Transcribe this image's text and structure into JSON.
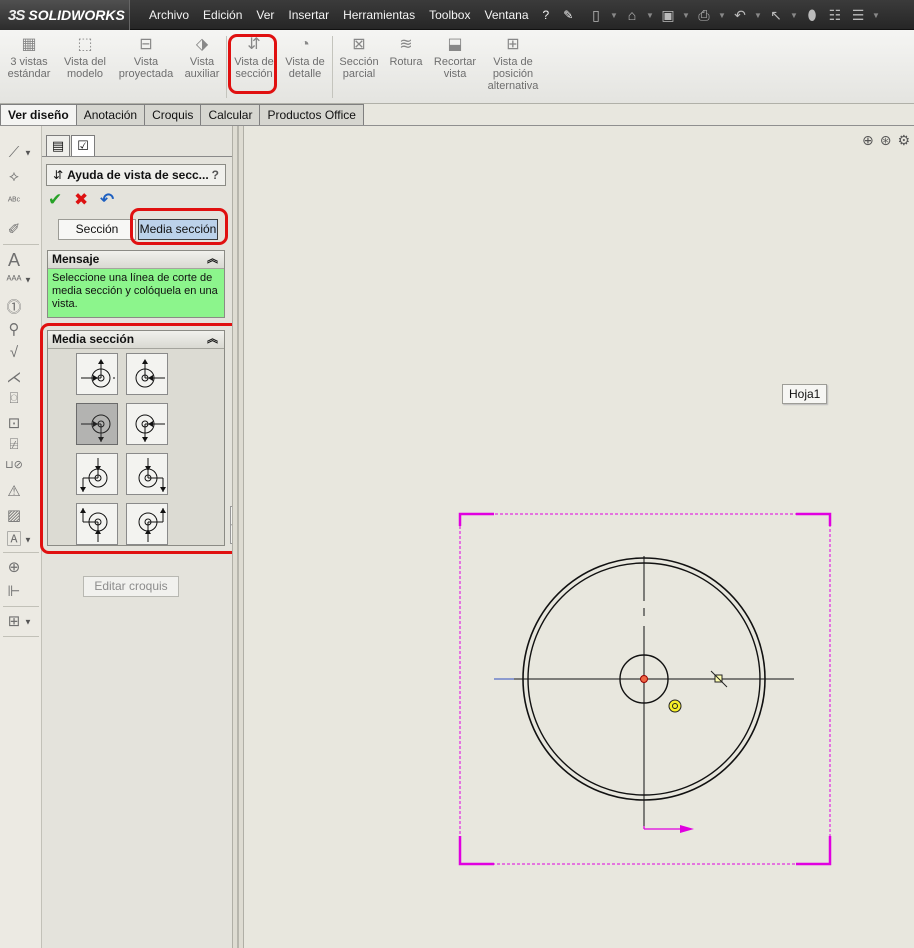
{
  "app": {
    "brand": "SOLIDWORKS",
    "brand_prefix": "3S"
  },
  "menu": [
    "Archivo",
    "Edición",
    "Ver",
    "Insertar",
    "Herramientas",
    "Toolbox",
    "Ventana",
    "?"
  ],
  "ribbon": {
    "buttons": [
      {
        "l1": "3 vistas",
        "l2": "estándar",
        "l3": "",
        "icon": "standard-3-views-icon"
      },
      {
        "l1": "Vista del",
        "l2": "modelo",
        "l3": "",
        "icon": "model-view-icon"
      },
      {
        "l1": "Vista",
        "l2": "proyectada",
        "l3": "",
        "icon": "projected-view-icon"
      },
      {
        "l1": "Vista",
        "l2": "auxiliar",
        "l3": "",
        "icon": "auxiliary-view-icon"
      },
      {
        "l1": "Vista de",
        "l2": "sección",
        "l3": "",
        "icon": "section-view-icon"
      },
      {
        "l1": "Vista de",
        "l2": "detalle",
        "l3": "",
        "icon": "detail-view-icon"
      },
      {
        "l1": "Sección",
        "l2": "parcial",
        "l3": "",
        "icon": "broken-out-section-icon"
      },
      {
        "l1": "Rotura",
        "l2": "",
        "l3": "",
        "icon": "break-icon"
      },
      {
        "l1": "Recortar",
        "l2": "vista",
        "l3": "",
        "icon": "crop-view-icon"
      },
      {
        "l1": "Vista de",
        "l2": "posición",
        "l3": "alternativa",
        "icon": "alternate-position-view-icon"
      }
    ]
  },
  "tabs": [
    "Ver diseño",
    "Anotación",
    "Croquis",
    "Calcular",
    "Productos Office"
  ],
  "property_manager": {
    "title": "Ayuda de vista de secc...",
    "help": "?",
    "toggle_section": "Sección",
    "toggle_half": "Media sección",
    "message_header": "Mensaje",
    "message_text": "Seleccione una línea de corte de media sección y colóquela en una vista.",
    "half_section_header": "Media sección",
    "edit_sketch": "Editar croquis"
  },
  "graphics": {
    "sheet_label": "Hoja1"
  },
  "colors": {
    "accent_red": "#e01010",
    "message_bg": "#8cf58c",
    "view_border": "#e000e0"
  }
}
